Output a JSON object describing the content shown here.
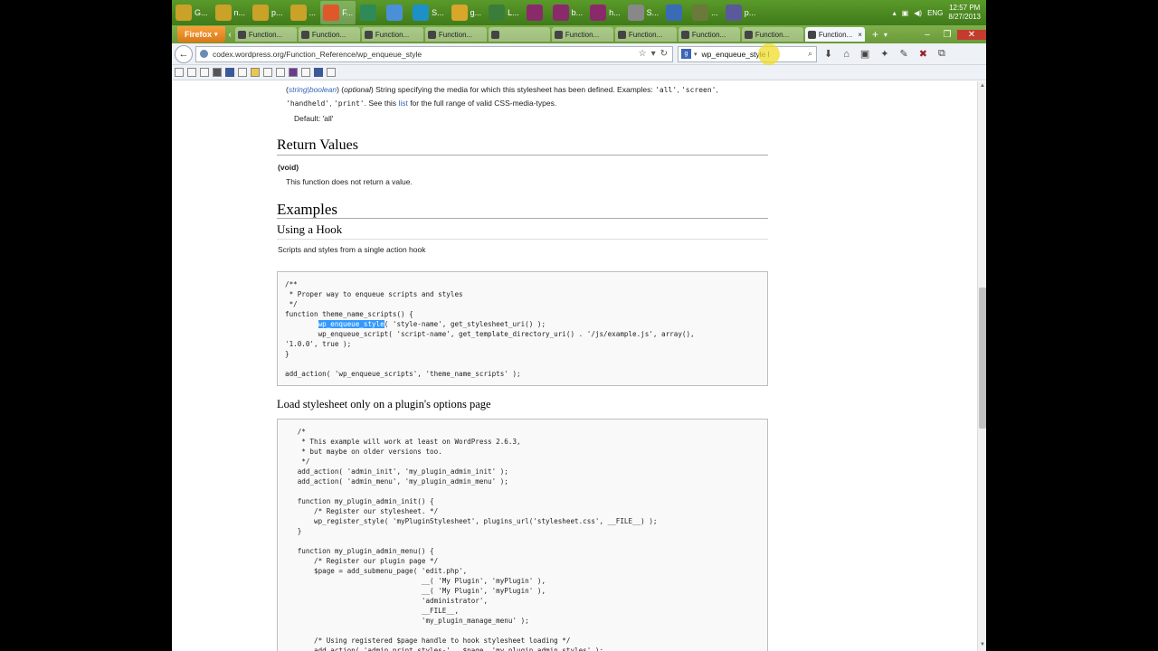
{
  "taskbar": {
    "items": [
      {
        "label": "G...",
        "color": "#c9a227"
      },
      {
        "label": "n...",
        "color": "#c9a227"
      },
      {
        "label": "p...",
        "color": "#c9a227"
      },
      {
        "label": "...",
        "color": "#c9a227"
      },
      {
        "label": "F...",
        "color": "#e0582a"
      },
      {
        "label": "",
        "color": "#2e8b57"
      },
      {
        "label": "",
        "color": "#4a90d9"
      },
      {
        "label": "S...",
        "color": "#1e90c8"
      },
      {
        "label": "g...",
        "color": "#d7a62a"
      },
      {
        "label": "L...",
        "color": "#3a7d3a"
      },
      {
        "label": "",
        "color": "#8b2a6b"
      },
      {
        "label": "b...",
        "color": "#8b2a6b"
      },
      {
        "label": "h...",
        "color": "#8b2a6b"
      },
      {
        "label": "S...",
        "color": "#888888"
      },
      {
        "label": "",
        "color": "#3a6bb5"
      },
      {
        "label": "...",
        "color": "#6b7a3a"
      },
      {
        "label": "p...",
        "color": "#5a5a9a"
      }
    ],
    "tray_lang": "ENG",
    "clock_time": "12:57 PM",
    "clock_date": "8/27/2013"
  },
  "tabbar": {
    "firefox_label": "Firefox",
    "tabs": [
      "Function...",
      "Function...",
      "Function...",
      "Function...",
      "",
      "Function...",
      "Function...",
      "Function...",
      "Function..."
    ],
    "active_tab": "Function...",
    "new_tab": "+",
    "close_glyph": "×"
  },
  "navbar": {
    "url": "codex.wordpress.org/Function_Reference/wp_enqueue_style",
    "search_value": "wp_enqueue_style"
  },
  "content": {
    "media_desc_prefix_a": "(",
    "media_desc_type": "string|boolean",
    "media_desc_prefix_b": ") (",
    "media_desc_optional": "optional",
    "media_desc_text": ") String specifying the media for which this stylesheet has been defined. Examples: ",
    "media_ex1": "'all'",
    "media_ex2": "'screen'",
    "media_ex3": "'handheld'",
    "media_ex4": "'print'",
    "media_see": ". See this ",
    "media_list_link": "list",
    "media_tail": " for the full range of valid CSS-media-types.",
    "default_label": "Default: 'all'",
    "return_heading": "Return Values",
    "return_type": "(void)",
    "return_text": "This function does not return a value.",
    "examples_heading": "Examples",
    "hook_heading": "Using a Hook",
    "hook_desc": "Scripts and styles from a single action hook",
    "code1_pre": "/**\n * Proper way to enqueue scripts and styles\n */\nfunction theme_name_scripts() {\n        ",
    "code1_highlight": "wp_enqueue_style",
    "code1_post": "( 'style-name', get_stylesheet_uri() );\n        wp_enqueue_script( 'script-name', get_template_directory_uri() . '/js/example.js', array(),\n'1.0.0', true );\n}\n\nadd_action( 'wp_enqueue_scripts', 'theme_name_scripts' );",
    "plugin_heading": "Load stylesheet only on a plugin's options page",
    "code2": "   /*\n    * This example will work at least on WordPress 2.6.3,\n    * but maybe on older versions too.\n    */\n   add_action( 'admin_init', 'my_plugin_admin_init' );\n   add_action( 'admin_menu', 'my_plugin_admin_menu' );\n\n   function my_plugin_admin_init() {\n       /* Register our stylesheet. */\n       wp_register_style( 'myPluginStylesheet', plugins_url('stylesheet.css', __FILE__) );\n   }\n\n   function my_plugin_admin_menu() {\n       /* Register our plugin page */\n       $page = add_submenu_page( 'edit.php',\n                                 __( 'My Plugin', 'myPlugin' ),\n                                 __( 'My Plugin', 'myPlugin' ),\n                                 'administrator',\n                                 __FILE__,\n                                 'my_plugin_manage_menu' );\n\n       /* Using registered $page handle to hook stylesheet loading */\n       add_action( 'admin_print_styles-' . $page, 'my_plugin_admin_styles' );"
  }
}
